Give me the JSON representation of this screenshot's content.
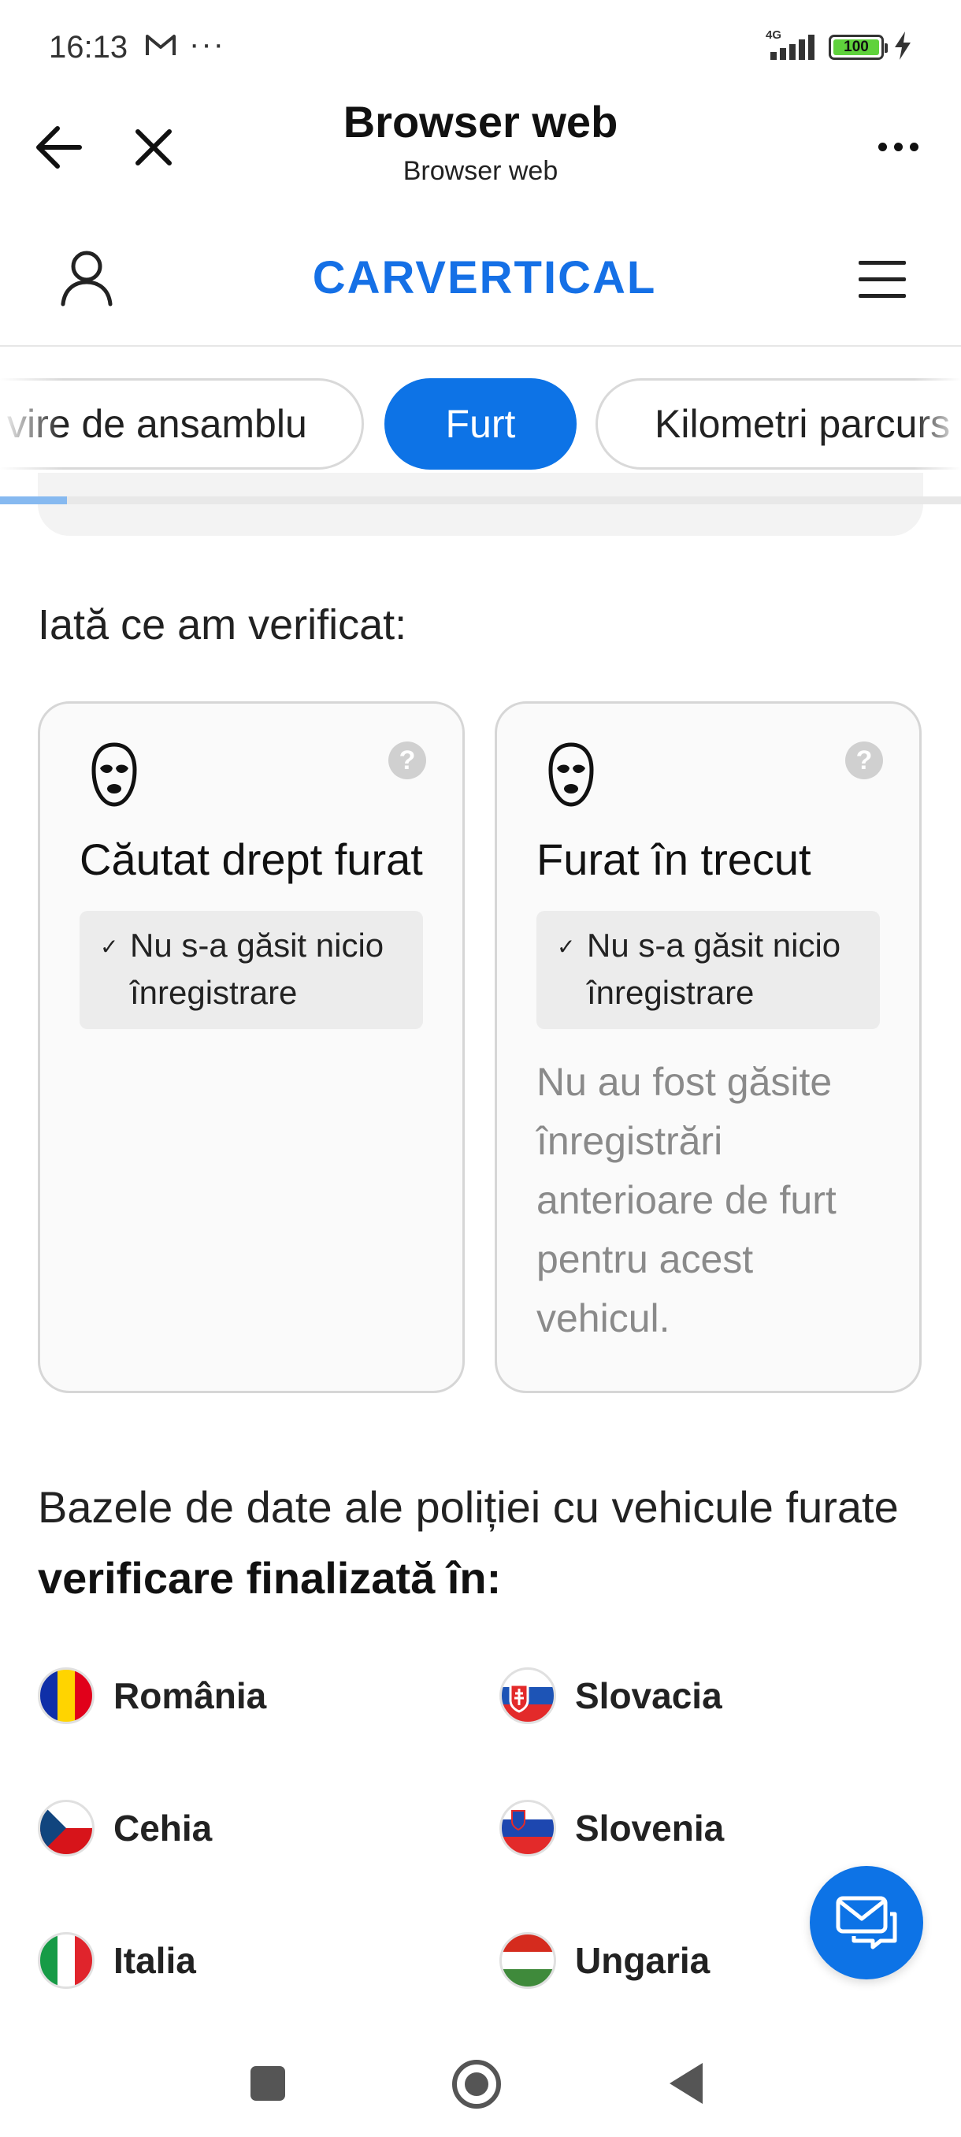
{
  "status_bar": {
    "time": "16:13",
    "overflow": "···",
    "network": "4G",
    "battery": "100",
    "icons": [
      "gmail-icon",
      "signal-icon",
      "battery-icon",
      "charging-icon"
    ]
  },
  "browser_header": {
    "title": "Browser web",
    "subtitle": "Browser web",
    "icons": [
      "back-arrow-icon",
      "close-icon",
      "more-icon"
    ]
  },
  "site_nav": {
    "logo": "CARVERTICAL",
    "brand_color": "#1570e6",
    "icons": [
      "account-icon",
      "menu-icon"
    ]
  },
  "tabs": [
    {
      "label": "Privire de ansamblu",
      "visible": "vire de ansamblu",
      "active": false
    },
    {
      "label": "Furt",
      "active": true
    },
    {
      "label": "Kilometri parcurși",
      "visible": "Kilometri parcurs",
      "active": false
    }
  ],
  "accent_color": "#0d73e6",
  "scroll_progress": 0.07,
  "checks": {
    "heading": "Iată ce am verificat:",
    "cards": [
      {
        "title": "Căutat drept furat",
        "status": "Nu s-a găsit nicio înregistrare",
        "description": "",
        "icon": "balaclava-icon",
        "help": "?"
      },
      {
        "title": "Furat în trecut",
        "status": "Nu s-a găsit nicio înregistrare",
        "description": "Nu au fost găsite înregistrări anterioare de furt pentru acest vehicul.",
        "icon": "balaclava-icon",
        "help": "?"
      }
    ]
  },
  "databases": {
    "intro_prefix": "Bazele de date ale poliției cu vehicule furate ",
    "intro_bold": "verificare finalizată în:",
    "countries": [
      {
        "name": "România",
        "flag": "romania-flag-icon"
      },
      {
        "name": "Slovacia",
        "flag": "slovakia-flag-icon"
      },
      {
        "name": "Cehia",
        "flag": "czechia-flag-icon"
      },
      {
        "name": "Slovenia",
        "flag": "slovenia-flag-icon"
      },
      {
        "name": "Italia",
        "flag": "italy-flag-icon"
      },
      {
        "name": "Ungaria",
        "flag": "hungary-flag-icon"
      }
    ]
  },
  "chat": {
    "icon": "chat-mail-icon"
  },
  "system_nav": {
    "icons": [
      "recents-icon",
      "home-icon",
      "back-icon"
    ]
  }
}
